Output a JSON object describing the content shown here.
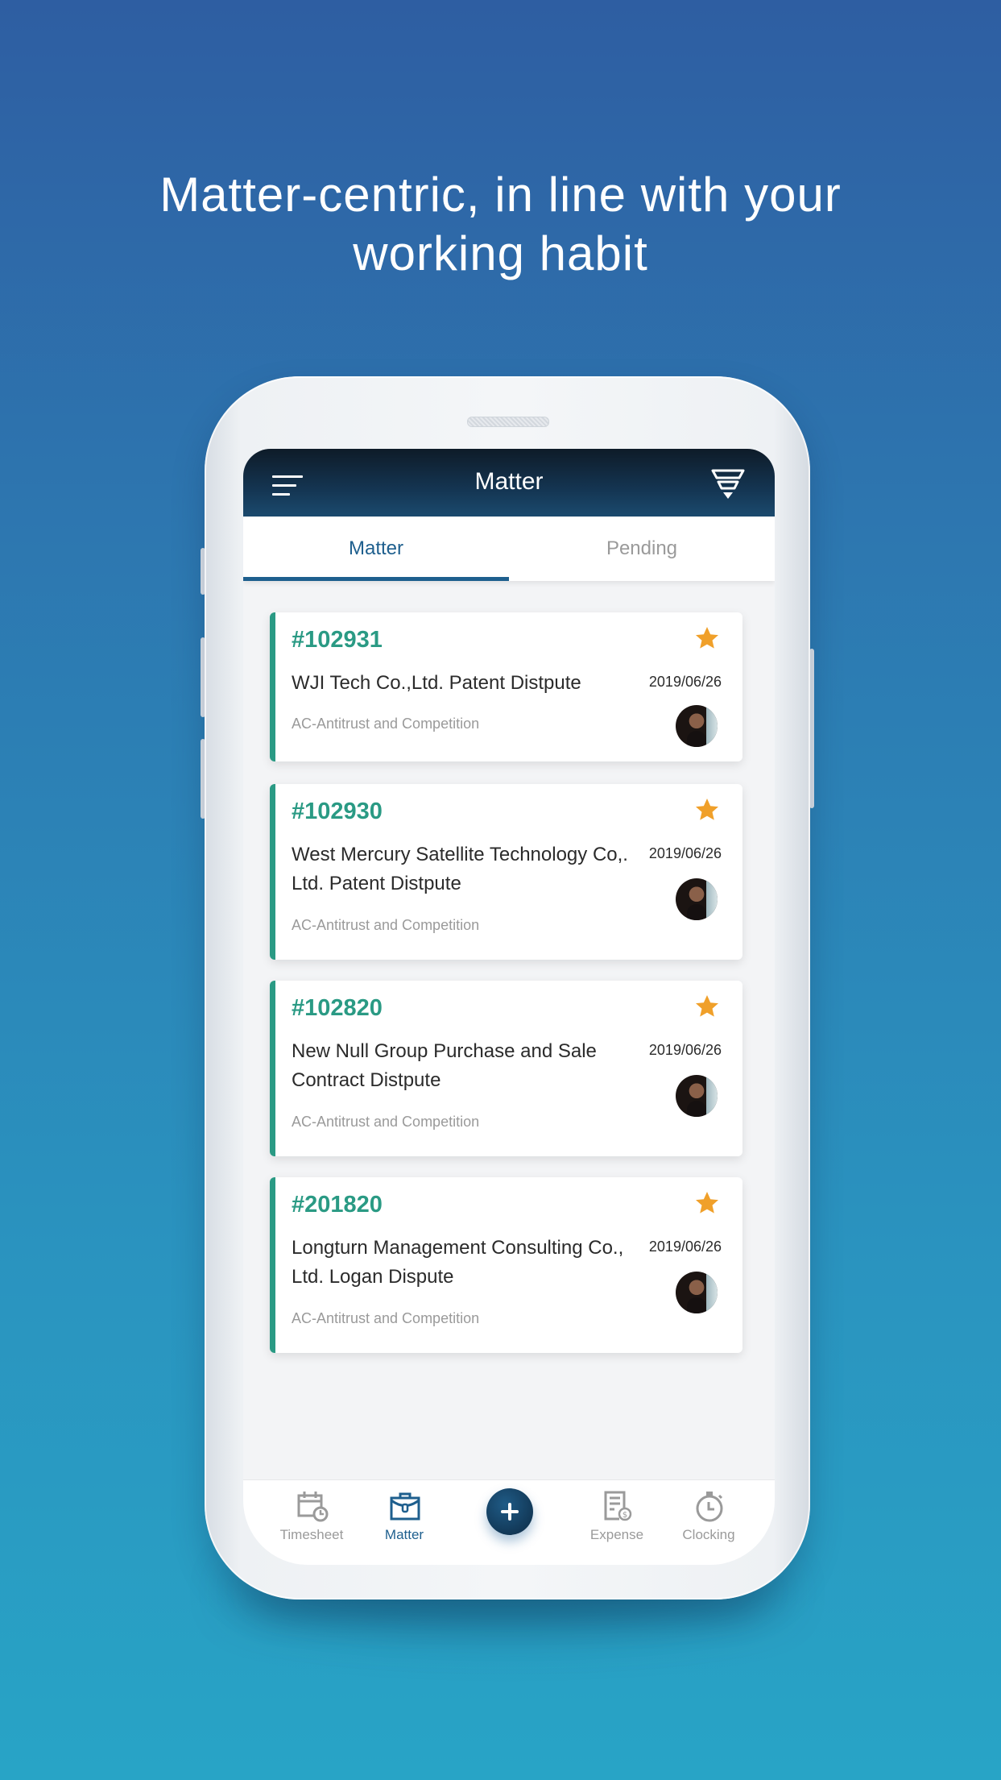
{
  "headline": {
    "line1": "Matter-centric, in line with your",
    "line2": "working habit"
  },
  "app": {
    "title": "Matter",
    "icons": {
      "menu": "hamburger-menu-icon",
      "filter": "funnel-filter-icon"
    },
    "tabs": [
      {
        "label": "Matter",
        "active": true
      },
      {
        "label": "Pending",
        "active": false
      }
    ],
    "accent_color": "#2a9a84",
    "star_color": "#f0a02a",
    "primary_color": "#1e5f8e",
    "matters": [
      {
        "number": "#102931",
        "name": "WJI Tech Co.,Ltd. Patent Distpute",
        "date": "2019/06/26",
        "category": "AC-Antitrust and Competition",
        "starred": true
      },
      {
        "number": "#102930",
        "name": "West Mercury Satellite Technology Co,. Ltd. Patent Distpute",
        "date": "2019/06/26",
        "category": "AC-Antitrust and Competition",
        "starred": true
      },
      {
        "number": "#102820",
        "name": "New Null Group Purchase and Sale Contract Distpute",
        "date": "2019/06/26",
        "category": "AC-Antitrust and Competition",
        "starred": true
      },
      {
        "number": "#201820",
        "name": "Longturn Management Consulting Co., Ltd. Logan Dispute",
        "date": "2019/06/26",
        "category": "AC-Antitrust and Competition",
        "starred": true
      }
    ],
    "bottom_nav": [
      {
        "label": "Timesheet",
        "icon": "calendar-clock-icon",
        "active": false
      },
      {
        "label": "Matter",
        "icon": "briefcase-icon",
        "active": true
      },
      {
        "label": "",
        "icon": "plus-icon",
        "active": false
      },
      {
        "label": "Expense",
        "icon": "receipt-dollar-icon",
        "active": false
      },
      {
        "label": "Clocking",
        "icon": "stopwatch-icon",
        "active": false
      }
    ]
  }
}
